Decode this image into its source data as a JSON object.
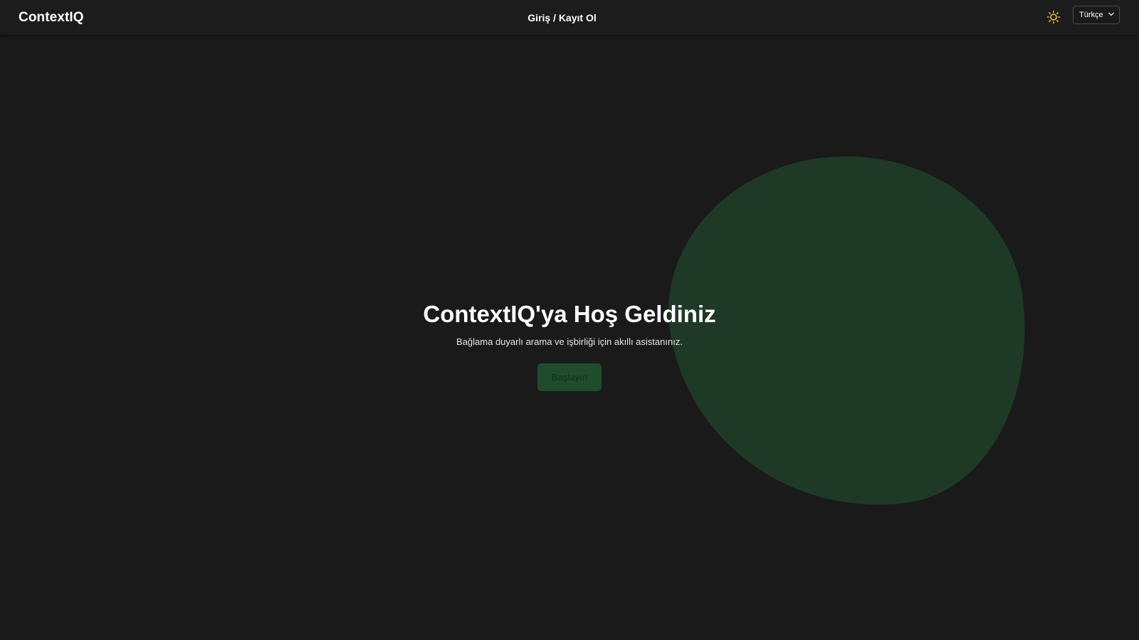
{
  "header": {
    "logo": "ContextIQ",
    "nav_link": "Giriş / Kayıt Ol",
    "theme_icon": "sun-icon",
    "language": {
      "selected": "Türkçe",
      "icon": "chevron-down-icon"
    }
  },
  "hero": {
    "title": "ContextIQ'ya Hoş Geldiniz",
    "subtitle": "Bağlama duyarlı arama ve işbirliği için akıllı asistanınız.",
    "cta_label": "Başlayın"
  },
  "colors": {
    "background": "#1a1a1a",
    "header_background": "#1c1c1c",
    "blob": "#1e3a27",
    "cta_background": "#1f4d2c",
    "cta_text": "#152a1c",
    "sun_icon": "#f5c518"
  }
}
